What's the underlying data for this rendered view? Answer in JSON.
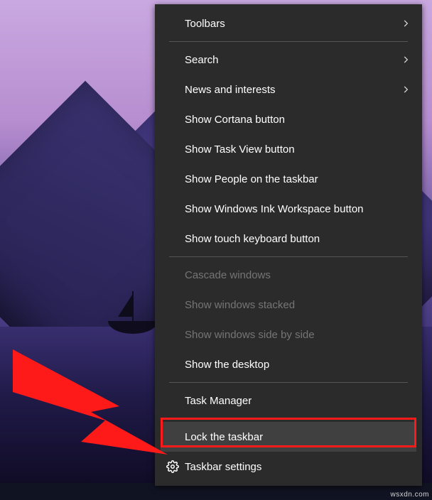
{
  "context_menu": {
    "toolbars": "Toolbars",
    "search": "Search",
    "news": "News and interests",
    "cortana": "Show Cortana button",
    "taskview": "Show Task View button",
    "people": "Show People on the taskbar",
    "ink": "Show Windows Ink Workspace button",
    "touchkb": "Show touch keyboard button",
    "cascade": "Cascade windows",
    "stacked": "Show windows stacked",
    "sidebyside": "Show windows side by side",
    "showdesktop": "Show the desktop",
    "taskmgr": "Task Manager",
    "lock": "Lock the taskbar",
    "settings": "Taskbar settings"
  },
  "watermark": "wsxdn.com"
}
